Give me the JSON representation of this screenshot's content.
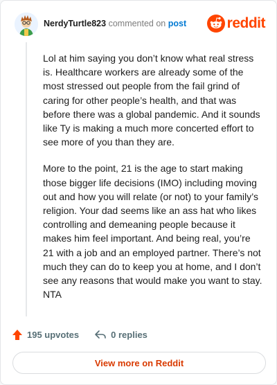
{
  "header": {
    "username": "NerdyTurtle823",
    "action_text": "commented on",
    "post_link": "post",
    "brand_name": "reddit"
  },
  "comment": {
    "paragraphs": [
      "Lol at him saying you don’t know what real stress is. Healthcare workers are already some of the most stressed out people from the fail grind of caring for other people’s health, and that was before there was a global pandemic. And it sounds like Ty is making a much more concerted effort to see more of you than they are.",
      "More to the point, 21 is the age to start making those bigger life decisions (IMO) including moving out and how you will relate (or not) to your family’s religion. Your dad seems like an ass hat who likes controlling and demeaning people because it makes him feel important. And being real, you’re 21 with a job and an employed partner. There’s not much they can do to keep you at home, and I don’t see any reasons that would make you want to stay. NTA"
    ]
  },
  "actions": {
    "upvotes": "195 upvotes",
    "replies": "0 replies"
  },
  "footer": {
    "view_more": "View more on Reddit"
  },
  "colors": {
    "brand": "#ff4500",
    "link": "#0079d3",
    "cta": "#d93a00"
  }
}
